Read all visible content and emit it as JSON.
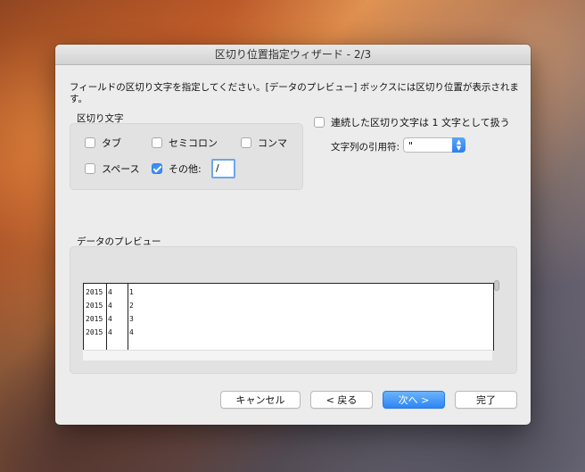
{
  "dialog": {
    "title": "区切り位置指定ウィザード - 2/3",
    "instruction": "フィールドの区切り文字を指定してください。[データのプレビュー] ボックスには区切り位置が表示されます。"
  },
  "delimiters": {
    "label": "区切り文字",
    "tab": {
      "label": "タブ",
      "checked": false
    },
    "semicolon": {
      "label": "セミコロン",
      "checked": false
    },
    "comma": {
      "label": "コンマ",
      "checked": false
    },
    "space": {
      "label": "スペース",
      "checked": false
    },
    "other": {
      "label": "その他:",
      "checked": true,
      "value": "/"
    }
  },
  "options": {
    "consecutive": {
      "label": "連続した区切り文字は 1 文字として扱う",
      "checked": false
    },
    "qualifier_label": "文字列の引用符:",
    "qualifier_value": "\""
  },
  "preview": {
    "label": "データのプレビュー",
    "rows": [
      [
        "2015",
        "4",
        "1"
      ],
      [
        "2015",
        "4",
        "2"
      ],
      [
        "2015",
        "4",
        "3"
      ],
      [
        "2015",
        "4",
        "4"
      ]
    ]
  },
  "buttons": {
    "cancel": "キャンセル",
    "back": "< 戻る",
    "next": "次へ >",
    "finish": "完了"
  },
  "colors": {
    "accent": "#3b8ff5",
    "dialog_bg": "#ececec"
  }
}
